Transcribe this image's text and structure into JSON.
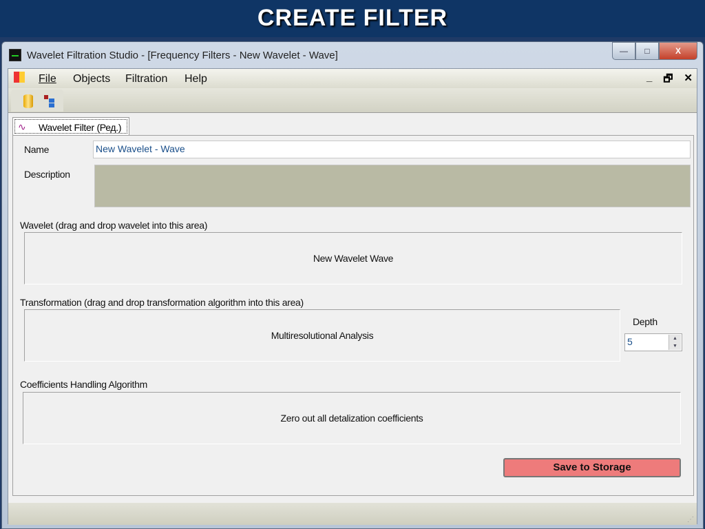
{
  "slide_title": "CREATE FILTER",
  "window": {
    "title": "Wavelet Filtration Studio - [Frequency Filters - New Wavelet - Wave]",
    "minimize": "—",
    "maximize": "□",
    "close": "X"
  },
  "menu": {
    "items": [
      "File",
      "Objects",
      "Filtration",
      "Help"
    ],
    "mdi_min": "_",
    "mdi_restore": "🗗",
    "mdi_close": "✕"
  },
  "tab": {
    "label": "Wavelet Filter (Ред.)"
  },
  "form": {
    "name_label": "Name",
    "name_value": "New Wavelet - Wave",
    "description_label": "Description",
    "wavelet_label": "Wavelet (drag and drop wavelet into this area)",
    "wavelet_value": "New Wavelet Wave",
    "transformation_label": "Transformation (drag and drop transformation algorithm into this area)",
    "transformation_value": "Multiresolutional Analysis",
    "depth_label": "Depth",
    "depth_value": "5",
    "coefficients_label": "Coefficients Handling Algorithm",
    "coefficients_value": "Zero out all detalization coefficients",
    "save_label": "Save to Storage"
  }
}
